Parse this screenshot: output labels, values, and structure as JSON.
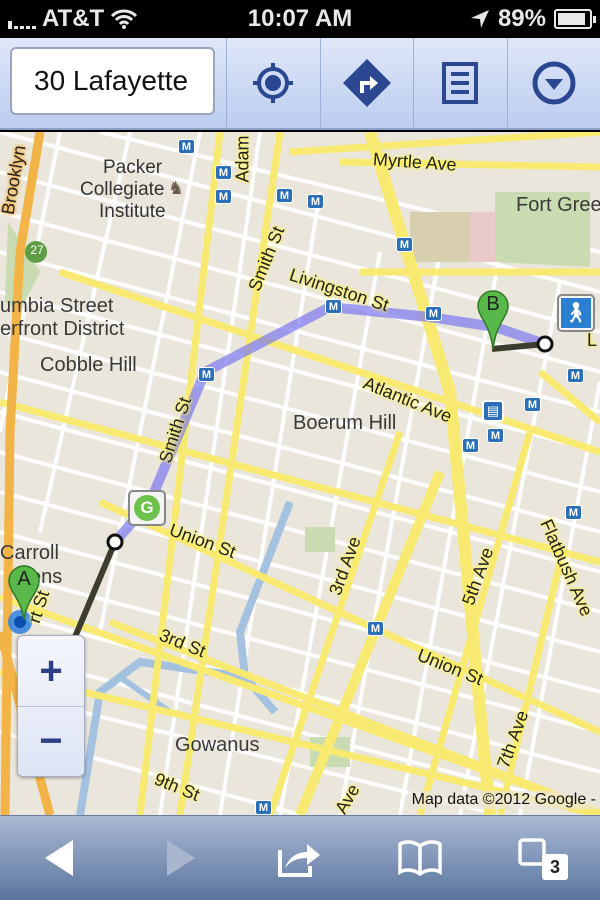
{
  "status_bar": {
    "carrier": "AT&T",
    "time": "10:07 AM",
    "battery": "89%",
    "battery_level": 0.89
  },
  "toolbar": {
    "search_value": "30 Lafayette",
    "buttons": [
      {
        "name": "my-location",
        "icon": "crosshair-icon"
      },
      {
        "name": "directions",
        "icon": "directions-diamond-icon"
      },
      {
        "name": "list",
        "icon": "list-icon"
      },
      {
        "name": "menu",
        "icon": "dropdown-circle-icon"
      }
    ]
  },
  "map": {
    "places": {
      "packer1": "Packer",
      "packer2": "Collegiate",
      "packer3": "Institute",
      "columbia1": "umbia Street",
      "columbia2": "erfront District",
      "cobble": "Cobble Hill",
      "boerum": "Boerum Hill",
      "fortgreene": "Fort Gree",
      "carroll1": "Carroll",
      "carroll2": "ens",
      "gowanus": "Gowanus"
    },
    "streets": {
      "brooklyn": "Brooklyn",
      "adams": "Adam",
      "smith1": "Smith St",
      "smith2": "Smith St",
      "livingston": "Livingston St",
      "myrtle": "Myrtle Ave",
      "atlantic": "Atlantic Ave",
      "union1": "Union St",
      "union2": "Union St",
      "third_st": "3rd St",
      "ninth_st": "9th St",
      "third_ave": "3rd Ave",
      "fifth_ave": "5th Ave",
      "seventh_ave": "7th Ave",
      "flatbush": "Flatbush Ave",
      "court": "rt St",
      "fourth_ave": "Ave",
      "l": "L"
    },
    "route_shield": "27",
    "marker_a": "A",
    "marker_b": "B",
    "transit_g": "G",
    "metro": "M",
    "attribution": "Map data ©2012 Google -",
    "zoom_in": "+",
    "zoom_out": "−"
  },
  "bottom_bar": {
    "tab_count": "3"
  }
}
